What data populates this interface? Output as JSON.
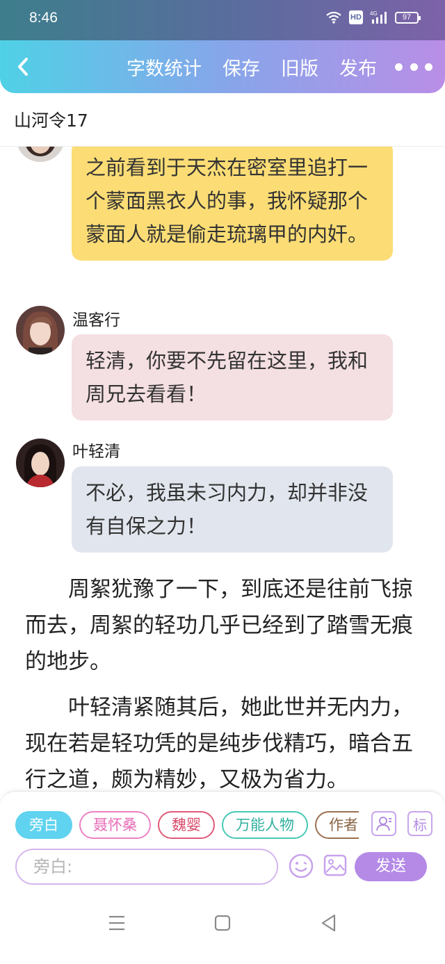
{
  "status_bar": {
    "time": "8:46",
    "hd": "HD",
    "signal": "4G",
    "battery": "97"
  },
  "header": {
    "toolbar": {
      "word_count": "字数统计",
      "save": "保存",
      "old_version": "旧版",
      "publish": "发布"
    }
  },
  "document": {
    "title": "山河令17"
  },
  "messages": [
    {
      "speaker": "",
      "text": "之前看到于天杰在密室里追打一个蒙面黑衣人的事，我怀疑那个蒙面人就是偷走琉璃甲的内奸。",
      "color": "#fcdd75"
    },
    {
      "speaker": "温客行",
      "text": "轻清，你要不先留在这里，我和周兄去看看！",
      "color": "#f4dfe2"
    },
    {
      "speaker": "叶轻清",
      "text": "不必，我虽未习内力，却并非没有自保之力！",
      "color": "#e1e6ee"
    }
  ],
  "paragraphs": [
    "周絮犹豫了一下，到底还是往前飞掠而去，周絮的轻功几乎已经到了踏雪无痕的地步。",
    "叶轻清紧随其后，她此世并无内力，现在若是轻功凭的是纯步伐精巧，暗合五行之道，颇为精妙，又极为省力。"
  ],
  "role_chips": [
    "旁白",
    "聂怀桑",
    "魏婴",
    "万能人物",
    "作者"
  ],
  "panel": {
    "label_btn": "标",
    "input_placeholder": "旁白:",
    "send": "发送"
  }
}
